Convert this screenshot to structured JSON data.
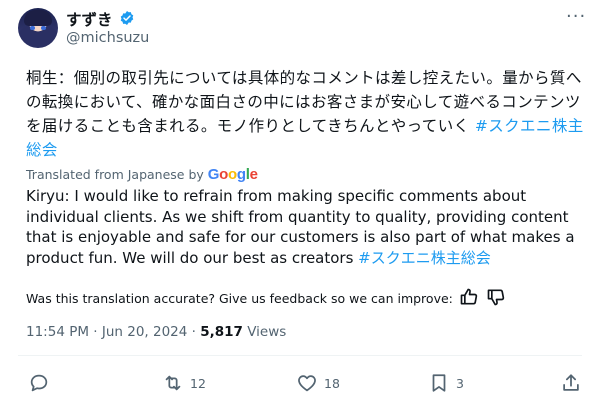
{
  "author": {
    "display_name": "すずき",
    "handle": "@michsuzu",
    "verified_color": "#1d9bf0",
    "avatar_icon": "avatar-icon"
  },
  "tweet": {
    "text_jp": "桐生：個別の取引先については具体的なコメントは差し控えたい。量から質への転換において、確かな面白さの中にはお客さまが安心して遊べるコンテンツを届けることも含まれる。モノ作りとしてきちんとやっていく ",
    "hashtag_jp": "#スクエニ株主総会",
    "translated_label": "Translated from Japanese by",
    "translated_provider": "Google",
    "text_en": "Kiryu: I would like to refrain from making specific comments about individual clients. As we shift from quantity to quality, providing content that is enjoyable and safe for our customers is also part of what makes a product fun. We will do our best as creators ",
    "hashtag_en": "#スクエニ株主総会",
    "feedback_prompt": "Was this translation accurate? Give us feedback so we can improve:",
    "time": "11:54 PM · Jun 20, 2024 · ",
    "views_count": "5,817",
    "views_label": " Views"
  },
  "actions": {
    "reply_count": "",
    "retweet_count": "12",
    "like_count": "18",
    "bookmark_count": "3"
  },
  "colors": {
    "accent": "#1d9bf0",
    "secondary_text": "#536471"
  }
}
